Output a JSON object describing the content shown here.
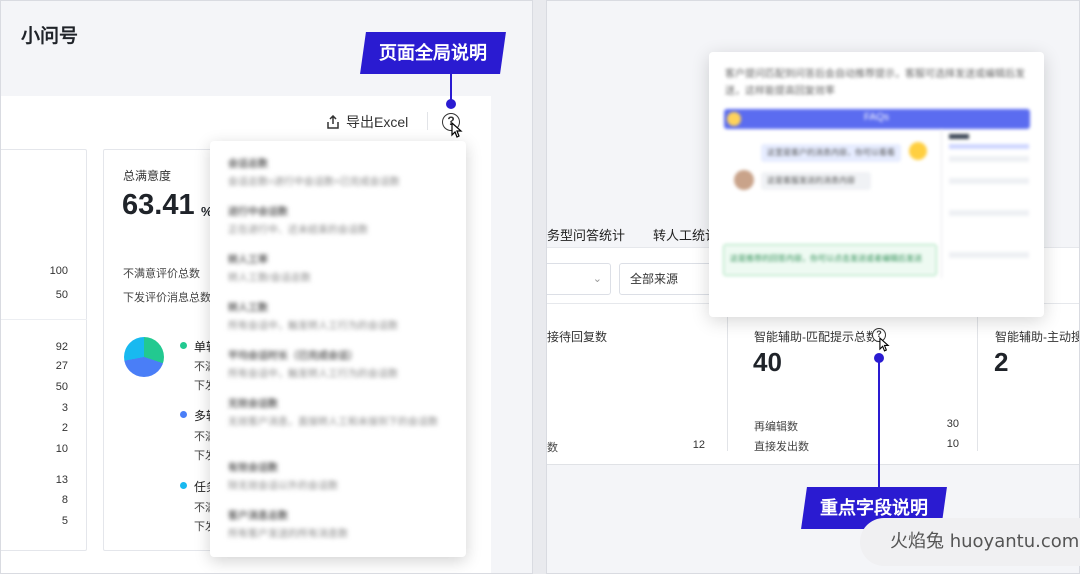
{
  "left": {
    "app_title": "小问号",
    "export_label": "导出Excel",
    "help_icon": "?",
    "callout": "页面全局说明",
    "col_numbers_a": [
      "100",
      "50"
    ],
    "col_numbers_b": [
      "92",
      "27",
      "50",
      "3",
      "2",
      "10",
      "13",
      "8",
      "5"
    ],
    "card": {
      "title": "总满意度",
      "value": "63.41",
      "unit": "%",
      "row1": "不满意评价总数",
      "row2": "下发评价消息总数",
      "legend": [
        {
          "label": "单轮",
          "sub1": "不满",
          "sub2": "下发",
          "color": "#22c990"
        },
        {
          "label": "多轮",
          "sub1": "不满",
          "sub2": "下发",
          "color": "#4a7ef7"
        },
        {
          "label": "任务",
          "sub1": "不满",
          "sub2": "下发",
          "color": "#18b9f0"
        }
      ]
    },
    "dropdown": [
      {
        "title": "会话总数",
        "desc": "会话总数=进行中会话数+已完成会话数"
      },
      {
        "title": "进行中会话数",
        "desc": "正在进行中、还未结束的会话数"
      },
      {
        "title": "转人工率",
        "desc": "转人工数/会话总数"
      },
      {
        "title": "转人工数",
        "desc": "所有会话中，触发转人工行为的会话数"
      },
      {
        "title": "平均会话时长（已完成会话）",
        "desc": "所有会话中，触发转人工行为的会话数"
      },
      {
        "title": "无效会话数",
        "desc": "无效客户消息，直接转人工和未接到下的会话数"
      },
      {
        "title": "有效会话数",
        "desc": "除无效会话以外的会话数"
      },
      {
        "title": "客户消息总数",
        "desc": "所有客户发送的所有消息数"
      }
    ]
  },
  "right": {
    "callout": "重点字段说明",
    "tab_partial_1": "务型问答统计",
    "tab_partial_2": "转人工统计",
    "select_source": "全部来源",
    "col1_label": "接待回复数",
    "col1_sub": "数",
    "col1_sub_value": "12",
    "col2_label": "智能辅助-匹配提示总数",
    "col2_value": "40",
    "col2_rows": [
      {
        "label": "再编辑数",
        "value": "30"
      },
      {
        "label": "直接发出数",
        "value": "10"
      }
    ],
    "col3_label": "智能辅助-主动搜",
    "col3_value": "2",
    "popover": {
      "desc": "客户提问匹配到问答后会自动推荐提示，客服可选择发送或编辑后发送，这样能提高回复效率",
      "banner": "FAQs",
      "chat1": "这里是客户的消息内容，你可以看看",
      "chat2": "这是客服发送的消息内容",
      "suggest": "这是推荐的回答内容，你可以点击发送或者编辑后发送"
    }
  },
  "watermark": "火焰兔 huoyantu.com",
  "colors": {
    "accent": "#2a1bd1"
  }
}
